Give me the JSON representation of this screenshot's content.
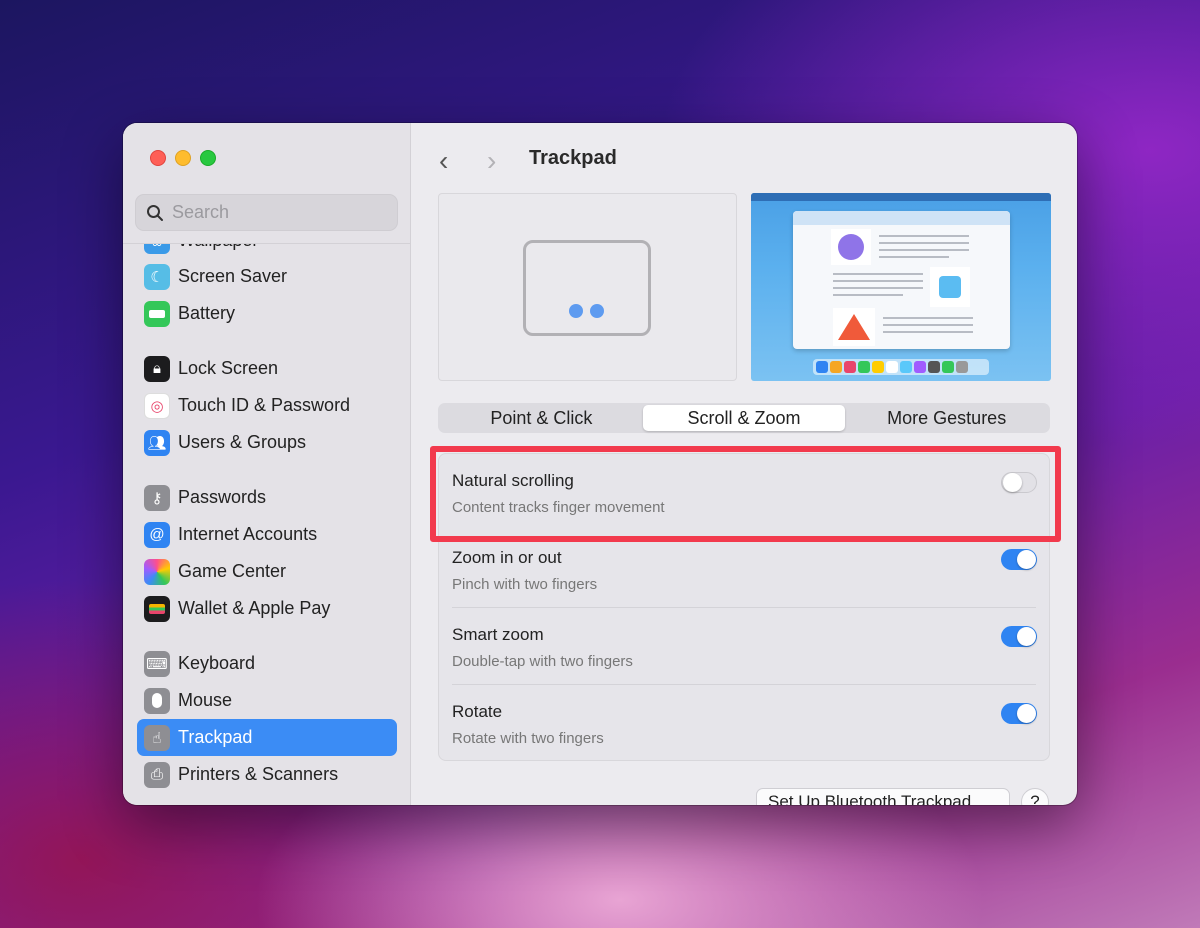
{
  "sidebar": {
    "search_placeholder": "Search",
    "items": [
      {
        "label": "Wallpaper",
        "icon": "wallpaper-icon",
        "color": "#3a9ae8"
      },
      {
        "label": "Screen Saver",
        "icon": "screen-saver-icon",
        "color": "#4fb6e0"
      },
      {
        "label": "Battery",
        "icon": "battery-icon",
        "color": "#34c759"
      },
      {
        "label": "Lock Screen",
        "icon": "lock-icon",
        "color": "#1c1c1e"
      },
      {
        "label": "Touch ID & Password",
        "icon": "fingerprint-icon",
        "color": "#ffffff"
      },
      {
        "label": "Users & Groups",
        "icon": "users-icon",
        "color": "#2f84f2"
      },
      {
        "label": "Passwords",
        "icon": "key-icon",
        "color": "#8e8e93"
      },
      {
        "label": "Internet Accounts",
        "icon": "at-icon",
        "color": "#2f84f2"
      },
      {
        "label": "Game Center",
        "icon": "game-center-icon",
        "color": "#ffffff"
      },
      {
        "label": "Wallet & Apple Pay",
        "icon": "wallet-icon",
        "color": "#1c1c1e"
      },
      {
        "label": "Keyboard",
        "icon": "keyboard-icon",
        "color": "#8e8e93"
      },
      {
        "label": "Mouse",
        "icon": "mouse-icon",
        "color": "#8e8e93"
      },
      {
        "label": "Trackpad",
        "icon": "trackpad-icon",
        "color": "#8e8e93"
      },
      {
        "label": "Printers & Scanners",
        "icon": "printer-icon",
        "color": "#8e8e93"
      }
    ],
    "active": "Trackpad"
  },
  "header": {
    "title": "Trackpad",
    "back": "‹",
    "forward": "›"
  },
  "tabs": [
    {
      "label": "Point & Click",
      "active": false
    },
    {
      "label": "Scroll & Zoom",
      "active": true
    },
    {
      "label": "More Gestures",
      "active": false
    }
  ],
  "settings": [
    {
      "label": "Natural scrolling",
      "sub": "Content tracks finger movement",
      "on": false
    },
    {
      "label": "Zoom in or out",
      "sub": "Pinch with two fingers",
      "on": true
    },
    {
      "label": "Smart zoom",
      "sub": "Double-tap with two fingers",
      "on": true
    },
    {
      "label": "Rotate",
      "sub": "Rotate with two fingers",
      "on": true
    }
  ],
  "footer": {
    "setup_label": "Set Up Bluetooth Trackpad",
    "help_label": "?"
  },
  "colors": {
    "accent": "#2f84f2",
    "highlight": "#f23a4d"
  }
}
